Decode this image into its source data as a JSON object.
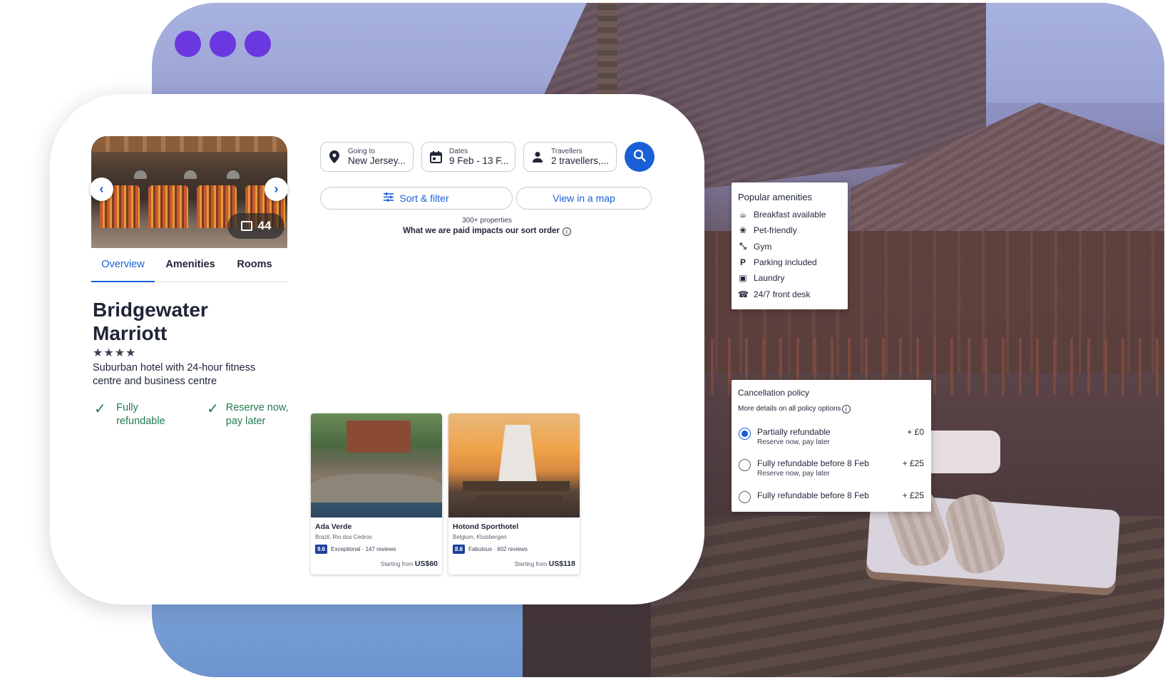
{
  "hotel": {
    "photo_count": "44",
    "tabs": [
      "Overview",
      "Amenities",
      "Rooms"
    ],
    "name": "Bridgewater Marriott",
    "stars": "★★★★",
    "description": "Suburban hotel with 24-hour fitness centre and business centre",
    "features": [
      "Fully refundable",
      "Reserve now, pay later"
    ]
  },
  "search": {
    "destination": {
      "label": "Going to",
      "value": "New Jersey..."
    },
    "dates": {
      "label": "Dates",
      "value": "9 Feb - 13 F..."
    },
    "travellers": {
      "label": "Travellers",
      "value": "2 travellers,..."
    },
    "sort_filter_label": "Sort & filter",
    "map_label": "View in a map",
    "property_count": "300+ properties",
    "sort_note": "What we are paid impacts our sort order"
  },
  "properties": [
    {
      "name": "Ada Verde",
      "location": "Brazil, Rio dos Cedros",
      "score": "9.6",
      "rating_text": "Exceptional · 147 reviews",
      "price_prefix": "Starting from",
      "price": "US$60"
    },
    {
      "name": "Hotond Sporthotel",
      "location": "Belgium, Kluisbergen",
      "score": "8.8",
      "rating_text": "Fabulous · 602 reviews",
      "price_prefix": "Starting from",
      "price": "US$118"
    }
  ],
  "amenities": {
    "title": "Popular amenities",
    "items": [
      {
        "icon": "breakfast-icon",
        "label": "Breakfast available"
      },
      {
        "icon": "paw-icon",
        "label": "Pet-friendly"
      },
      {
        "icon": "gym-icon",
        "label": "Gym"
      },
      {
        "icon": "parking-icon",
        "label": "Parking included"
      },
      {
        "icon": "laundry-icon",
        "label": "Laundry"
      },
      {
        "icon": "front-desk-icon",
        "label": "24/7 front desk"
      }
    ]
  },
  "cancellation": {
    "title": "Cancellation policy",
    "details": "More details on all policy options",
    "options": [
      {
        "label": "Partially refundable",
        "sub": "Reserve now, pay later",
        "price": "+ £0",
        "selected": true
      },
      {
        "label": "Fully refundable before 8 Feb",
        "sub": "Reserve now, pay later",
        "price": "+ £25",
        "selected": false
      },
      {
        "label": "Fully refundable before 8 Feb",
        "sub": "",
        "price": "+ £25",
        "selected": false
      }
    ]
  },
  "colors": {
    "accent": "#1a5fd6",
    "brand_dots": "#6b37e0",
    "refund_green": "#237a4e",
    "score_badge": "#1d3f9c"
  }
}
